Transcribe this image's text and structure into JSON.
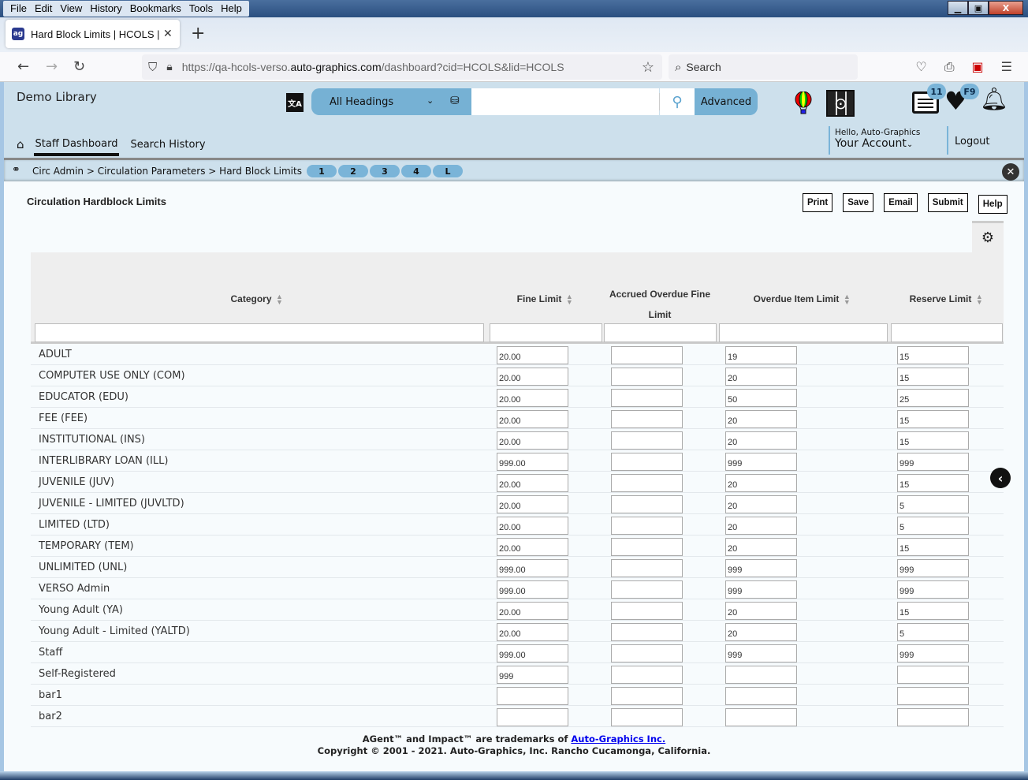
{
  "browser": {
    "menu": [
      "File",
      "Edit",
      "View",
      "History",
      "Bookmarks",
      "Tools",
      "Help"
    ],
    "tab_title": "Hard Block Limits | HCOLS | hcols",
    "url_prefix": "https://qa-hcols-verso.",
    "url_domain": "auto-graphics.com",
    "url_suffix": "/dashboard?cid=HCOLS&lid=HCOLS",
    "search_placeholder": "Search"
  },
  "header": {
    "library_name": "Demo Library",
    "heading_select": "All Headings",
    "search_value": "",
    "advanced_label": "Advanced",
    "list_badge": "11",
    "heart_badge": "F9",
    "nav": {
      "staff_dashboard": "Staff Dashboard",
      "search_history": "Search History"
    },
    "hello": "Hello, Auto-Graphics",
    "your_account": "Your Account",
    "logout": "Logout"
  },
  "breadcrumb": {
    "text": "Circ Admin > Circulation Parameters > Hard Block Limits",
    "pills": [
      "1",
      "2",
      "3",
      "4",
      "L"
    ]
  },
  "page": {
    "title": "Circulation Hardblock Limits",
    "actions": {
      "print": "Print",
      "save": "Save",
      "email": "Email",
      "submit": "Submit",
      "help": "Help"
    }
  },
  "table": {
    "columns": {
      "category": "Category",
      "fine_limit": "Fine Limit",
      "accrued_line1": "Accrued Overdue Fine",
      "accrued_line2": "Limit",
      "overdue_item_limit": "Overdue Item Limit",
      "reserve_limit": "Reserve Limit"
    },
    "rows": [
      {
        "category": "ADULT",
        "fine": "20.00",
        "accrued": "",
        "overdue": "19",
        "reserve": "15"
      },
      {
        "category": "COMPUTER USE ONLY (COM)",
        "fine": "20.00",
        "accrued": "",
        "overdue": "20",
        "reserve": "15"
      },
      {
        "category": "EDUCATOR (EDU)",
        "fine": "20.00",
        "accrued": "",
        "overdue": "50",
        "reserve": "25"
      },
      {
        "category": "FEE (FEE)",
        "fine": "20.00",
        "accrued": "",
        "overdue": "20",
        "reserve": "15"
      },
      {
        "category": "INSTITUTIONAL (INS)",
        "fine": "20.00",
        "accrued": "",
        "overdue": "20",
        "reserve": "15"
      },
      {
        "category": "INTERLIBRARY LOAN (ILL)",
        "fine": "999.00",
        "accrued": "",
        "overdue": "999",
        "reserve": "999"
      },
      {
        "category": "JUVENILE (JUV)",
        "fine": "20.00",
        "accrued": "",
        "overdue": "20",
        "reserve": "15"
      },
      {
        "category": "JUVENILE - LIMITED (JUVLTD)",
        "fine": "20.00",
        "accrued": "",
        "overdue": "20",
        "reserve": "5"
      },
      {
        "category": "LIMITED (LTD)",
        "fine": "20.00",
        "accrued": "",
        "overdue": "20",
        "reserve": "5"
      },
      {
        "category": "TEMPORARY (TEM)",
        "fine": "20.00",
        "accrued": "",
        "overdue": "20",
        "reserve": "15"
      },
      {
        "category": "UNLIMITED (UNL)",
        "fine": "999.00",
        "accrued": "",
        "overdue": "999",
        "reserve": "999"
      },
      {
        "category": "VERSO Admin",
        "fine": "999.00",
        "accrued": "",
        "overdue": "999",
        "reserve": "999"
      },
      {
        "category": "Young Adult (YA)",
        "fine": "20.00",
        "accrued": "",
        "overdue": "20",
        "reserve": "15"
      },
      {
        "category": "Young Adult - Limited (YALTD)",
        "fine": "20.00",
        "accrued": "",
        "overdue": "20",
        "reserve": "5"
      },
      {
        "category": "Staff",
        "fine": "999.00",
        "accrued": "",
        "overdue": "999",
        "reserve": "999"
      },
      {
        "category": "Self-Registered",
        "fine": "999",
        "accrued": "",
        "overdue": "",
        "reserve": ""
      },
      {
        "category": "bar1",
        "fine": "",
        "accrued": "",
        "overdue": "",
        "reserve": ""
      },
      {
        "category": "bar2",
        "fine": "",
        "accrued": "",
        "overdue": "",
        "reserve": ""
      }
    ]
  },
  "footer": {
    "line1_prefix": "AGent™ and Impact™ are trademarks of ",
    "line1_link": "Auto-Graphics Inc.",
    "line2": "Copyright © 2001 - 2021. Auto-Graphics, Inc. Rancho Cucamonga, California."
  }
}
